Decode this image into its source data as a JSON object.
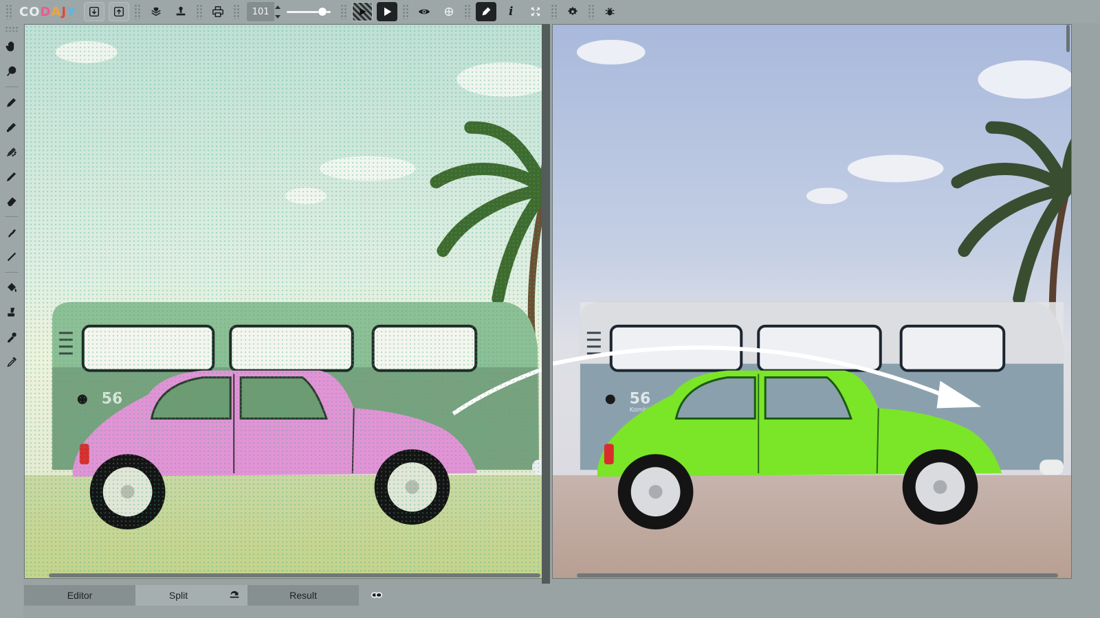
{
  "app": {
    "logo_letters": [
      {
        "ch": "C",
        "color": "#e8eded"
      },
      {
        "ch": "O",
        "color": "#e8eded"
      },
      {
        "ch": "D",
        "color": "#ee5a8c"
      },
      {
        "ch": "A",
        "color": "#f2a33a"
      },
      {
        "ch": "J",
        "color": "#e5453a"
      },
      {
        "ch": "Y",
        "color": "#5ab6e6"
      }
    ]
  },
  "toolbar": {
    "zoom_value": "101",
    "zoom_slider_level": 0.88,
    "buttons": [
      {
        "icon": "download-icon"
      },
      {
        "icon": "upload-icon"
      },
      {
        "icon": "layers-heart-icon"
      },
      {
        "icon": "stamp-icon"
      },
      {
        "icon": "print-icon"
      },
      {
        "icon": "play-striped-icon"
      },
      {
        "icon": "play-icon"
      },
      {
        "icon": "eye-icon"
      },
      {
        "icon": "hide-icon"
      },
      {
        "icon": "pencil-edit-icon"
      },
      {
        "icon": "info-icon"
      },
      {
        "icon": "fullscreen-icon"
      },
      {
        "icon": "settings-icon"
      },
      {
        "icon": "bug-icon"
      }
    ],
    "info_label": "i"
  },
  "toolbox": {
    "tools": [
      "hand-icon",
      "zoom-icon",
      "pencil-icon",
      "marker-icon",
      "spray-icon",
      "brush-icon",
      "eraser-icon",
      "smudge-icon",
      "line-icon",
      "fill-icon",
      "stamp-tool-icon",
      "color-picker-icon",
      "eyedropper-icon"
    ]
  },
  "canvas": {
    "left_car_color": "#e293d6",
    "right_car_color": "#7be528",
    "bus_left_color": "#8dbf95",
    "bus_right_color": "#8aa1ad",
    "arrow_color": "#ffffff",
    "bus_plate_number": "56",
    "bus_plate_text": "Kombi"
  },
  "tabs": {
    "editor": "Editor",
    "split": "Split",
    "result": "Result",
    "rotate_icon": "rotate-icon",
    "link_icon": "link-icon"
  }
}
